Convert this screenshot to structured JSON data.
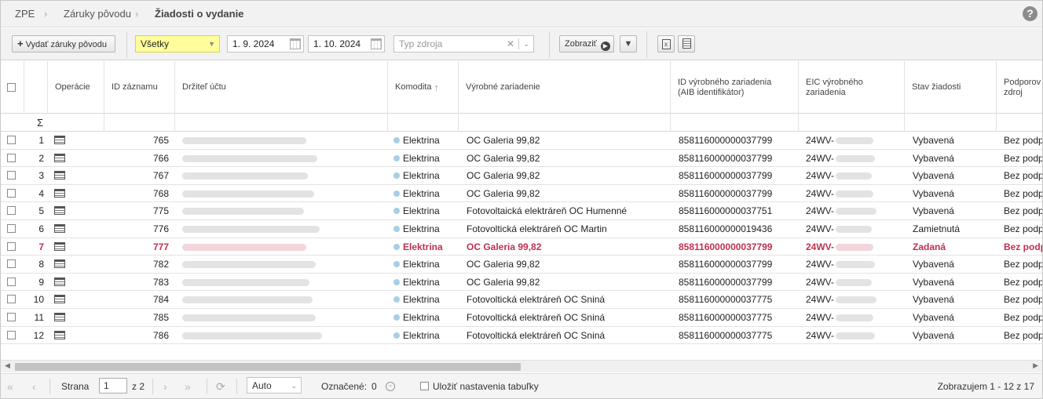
{
  "breadcrumb": {
    "items": [
      "ZPE",
      "Záruky pôvodu",
      "Žiadosti o vydanie"
    ],
    "help": "?"
  },
  "toolbar": {
    "issue_label": "Vydať záruky pôvodu",
    "filter_select": "Všetky",
    "date_from": "1. 9. 2024",
    "date_to": "1. 10. 2024",
    "source_placeholder": "Typ zdroja",
    "show_label": "Zobraziť"
  },
  "columns": {
    "operations": "Operácie",
    "record_id": "ID záznamu",
    "holder": "Držiteľ účtu",
    "commodity": "Komodita",
    "device": "Výrobné zariadenie",
    "device_id_1": "ID výrobného zariadenia",
    "device_id_2": "(AIB identifikátor)",
    "eic_1": "EIC výrobného",
    "eic_2": "zariadenia",
    "status": "Stav žiadosti",
    "support_1": "Podporov",
    "support_2": "zdroj"
  },
  "sum_symbol": "Σ",
  "rows": [
    {
      "n": "1",
      "id": "765",
      "commodity": "Elektrina",
      "device": "OC Galeria 99,82",
      "device_id": "858116000000037799",
      "eic": "24WV-",
      "status": "Vybavená",
      "support": "Bez podp",
      "highlight": false
    },
    {
      "n": "2",
      "id": "766",
      "commodity": "Elektrina",
      "device": "OC Galeria 99,82",
      "device_id": "858116000000037799",
      "eic": "24WV-",
      "status": "Vybavená",
      "support": "Bez podp",
      "highlight": false
    },
    {
      "n": "3",
      "id": "767",
      "commodity": "Elektrina",
      "device": "OC Galeria 99,82",
      "device_id": "858116000000037799",
      "eic": "24WV-",
      "status": "Vybavená",
      "support": "Bez podp",
      "highlight": false
    },
    {
      "n": "4",
      "id": "768",
      "commodity": "Elektrina",
      "device": "OC Galeria 99,82",
      "device_id": "858116000000037799",
      "eic": "24WV-",
      "status": "Vybavená",
      "support": "Bez podp",
      "highlight": false
    },
    {
      "n": "5",
      "id": "775",
      "commodity": "Elektrina",
      "device": "Fotovoltaická elektráreň OC Humenné",
      "device_id": "858116000000037751",
      "eic": "24WV-",
      "status": "Vybavená",
      "support": "Bez podp",
      "highlight": false
    },
    {
      "n": "6",
      "id": "776",
      "commodity": "Elektrina",
      "device": "Fotovoltická elektráreň OC Martin",
      "device_id": "858116000000019436",
      "eic": "24WV-",
      "status": "Zamietnutá",
      "support": "Bez podp",
      "highlight": false
    },
    {
      "n": "7",
      "id": "777",
      "commodity": "Elektrina",
      "device": "OC Galeria 99,82",
      "device_id": "858116000000037799",
      "eic": "24WV-",
      "status": "Zadaná",
      "support": "Bez podp",
      "highlight": true
    },
    {
      "n": "8",
      "id": "782",
      "commodity": "Elektrina",
      "device": "OC Galeria 99,82",
      "device_id": "858116000000037799",
      "eic": "24WV-",
      "status": "Vybavená",
      "support": "Bez podp",
      "highlight": false
    },
    {
      "n": "9",
      "id": "783",
      "commodity": "Elektrina",
      "device": "OC Galeria 99,82",
      "device_id": "858116000000037799",
      "eic": "24WV-",
      "status": "Vybavená",
      "support": "Bez podp",
      "highlight": false
    },
    {
      "n": "10",
      "id": "784",
      "commodity": "Elektrina",
      "device": "Fotovoltická elektráreň OC Sniná",
      "device_id": "858116000000037775",
      "eic": "24WV-",
      "status": "Vybavená",
      "support": "Bez podp",
      "highlight": false
    },
    {
      "n": "11",
      "id": "785",
      "commodity": "Elektrina",
      "device": "Fotovoltická elektráreň OC Sniná",
      "device_id": "858116000000037775",
      "eic": "24WV-",
      "status": "Vybavená",
      "support": "Bez podp",
      "highlight": false
    },
    {
      "n": "12",
      "id": "786",
      "commodity": "Elektrina",
      "device": "Fotovoltická elektráreň OC Sniná",
      "device_id": "858116000000037775",
      "eic": "24WV-",
      "status": "Vybavená",
      "support": "Bez podp",
      "highlight": false
    }
  ],
  "pager": {
    "page_label": "Strana",
    "page_value": "1",
    "page_of": "z 2",
    "size_select": "Auto",
    "marked_label": "Označené:",
    "marked_count": "0",
    "save_label": "Uložiť nastavenia tabuľky",
    "summary": "Zobrazujem 1 - 12 z 17"
  }
}
